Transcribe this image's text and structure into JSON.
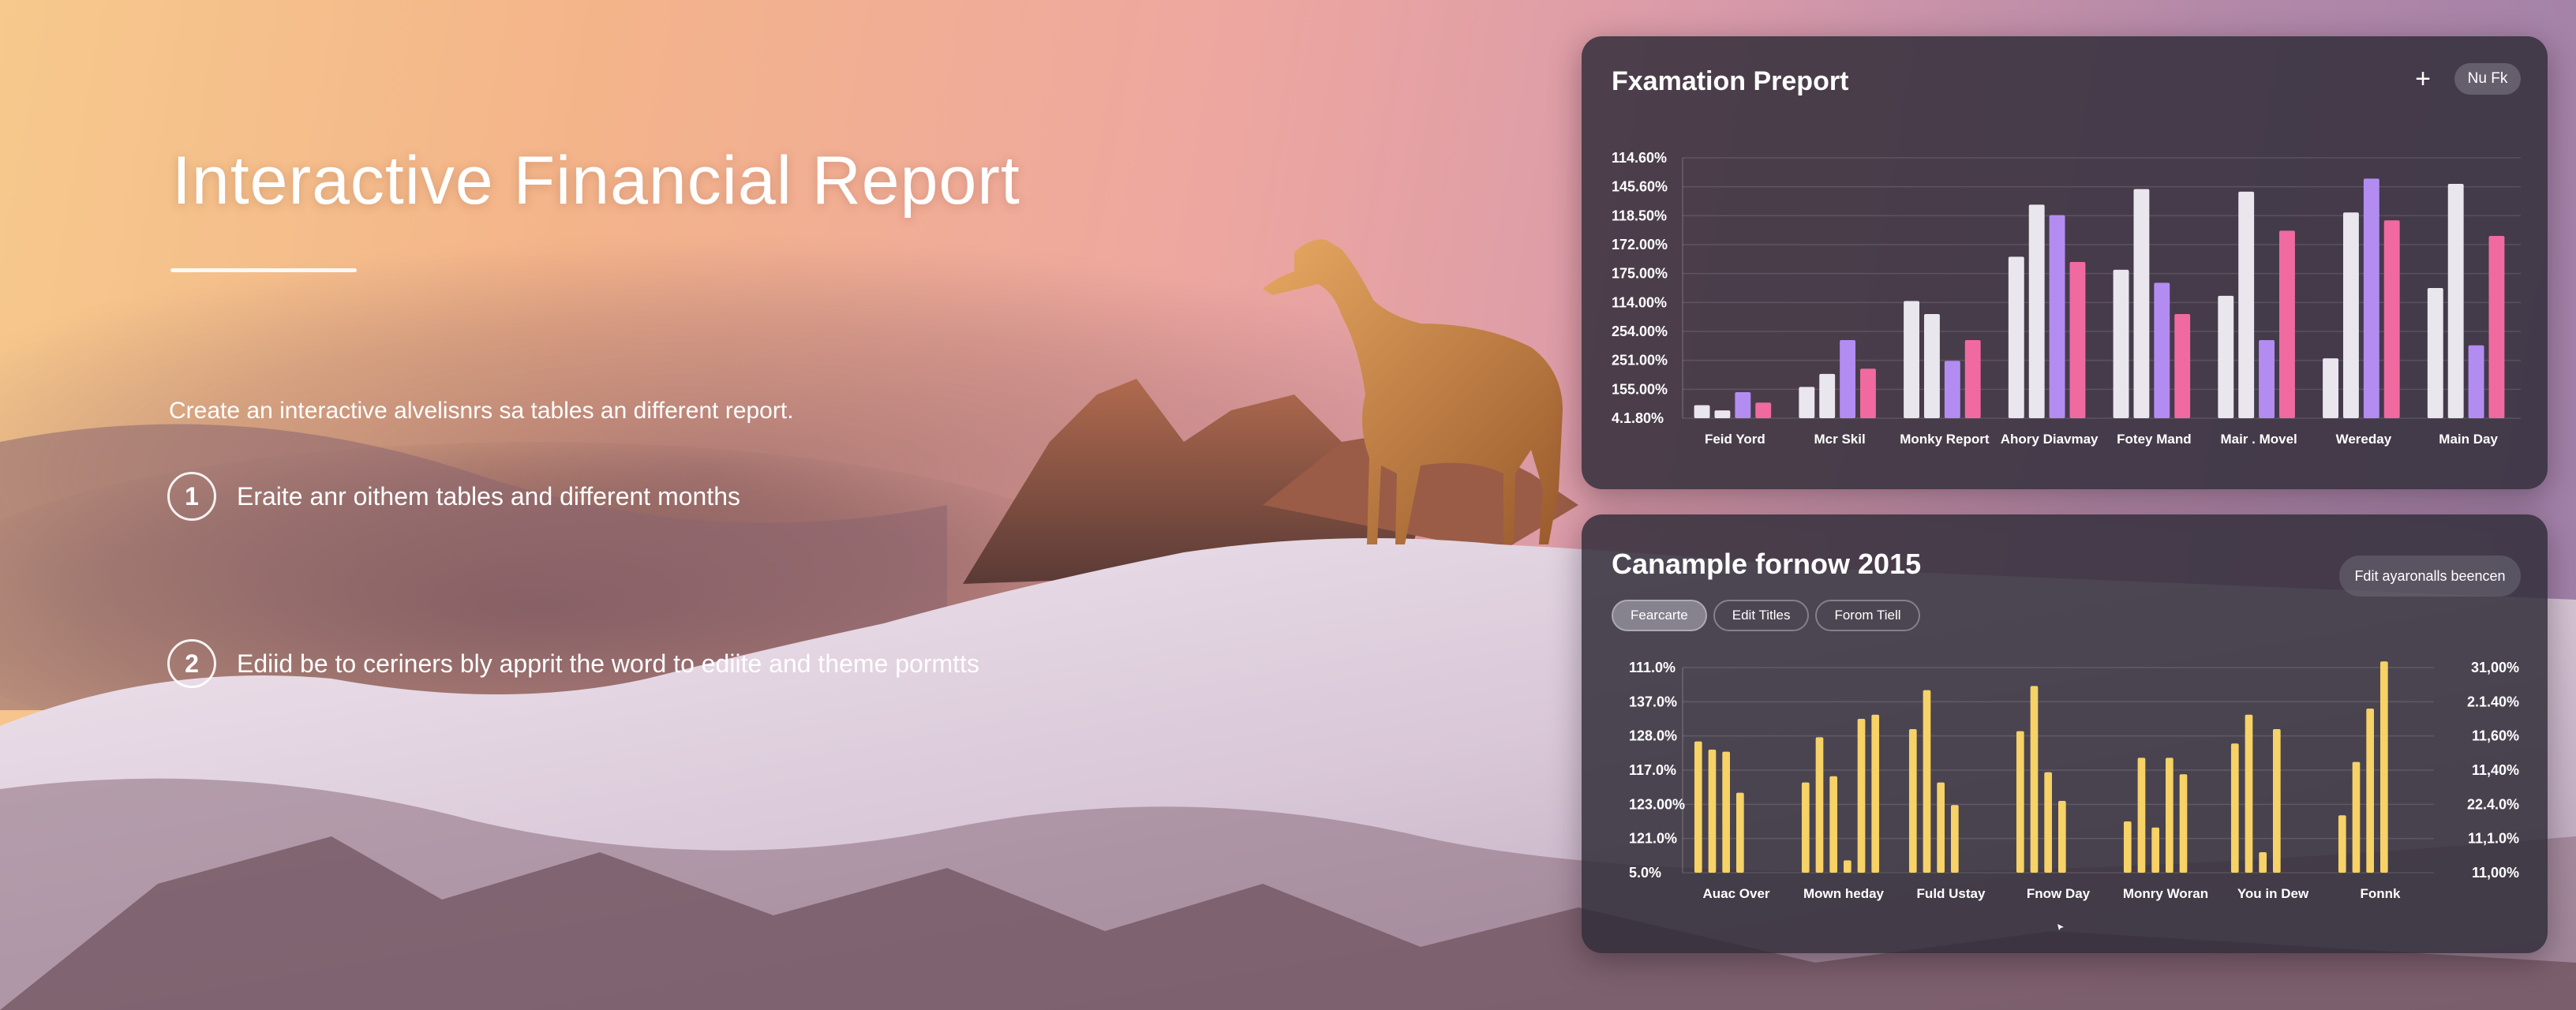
{
  "hero": {
    "title": "Interactive Financial Report",
    "subtitle": "Create an interactive alvelisnrs sa tables an different report.",
    "steps": [
      {
        "num": "1",
        "text": "Eraite anr oithem tables and different months"
      },
      {
        "num": "2",
        "text": "Ediid be to ceriners bly apprit the word to ediite and theme pormtts"
      }
    ]
  },
  "panel1": {
    "title": "Fxamation Preport",
    "plus_label": "+",
    "pill_label": "Nu Fk"
  },
  "panel2": {
    "title": "Canample fornow 2015",
    "edit_label": "Fdit ayaronalls beencen",
    "tabs": [
      "Fearcarte",
      "Edit Titles",
      "Forom Tiell"
    ]
  },
  "colors": {
    "white_bar": "#e9e6ee",
    "violet_bar": "#b38cf2",
    "pink_bar": "#f06aa0",
    "yellow_bar": "#f6d267",
    "panel_bg": "#302c38"
  },
  "chart_data": [
    {
      "type": "bar",
      "yticks": [
        "114.60%",
        "145.60%",
        "118.50%",
        "172.00%",
        "175.00%",
        "114.00%",
        "254.00%",
        "251.00%",
        "155.00%",
        "4.1.80%"
      ],
      "categories": [
        "Feid Yord",
        "Mcr Skil",
        "Monky Report",
        "Ahory Diavmay",
        "Fotey Mand",
        "Mair . Movel",
        "Wereday",
        "Main Day"
      ],
      "ylim": [
        0,
        100
      ],
      "grid": true,
      "series": [
        {
          "color": "#e9e6ee",
          "values": [
            5,
            12,
            45,
            62,
            57,
            47,
            23,
            50
          ]
        },
        {
          "color": "#e9e6ee",
          "values": [
            3,
            17,
            40,
            82,
            88,
            87,
            79,
            90
          ]
        },
        {
          "color": "#b38cf2",
          "values": [
            10,
            30,
            22,
            78,
            52,
            30,
            92,
            28
          ]
        },
        {
          "color": "#f06aa0",
          "values": [
            6,
            19,
            30,
            60,
            40,
            72,
            76,
            70
          ]
        }
      ]
    },
    {
      "type": "bar",
      "yticks_left": [
        "111.0%",
        "137.0%",
        "128.0%",
        "117.0%",
        "123.00%",
        "121.0%",
        "5.0%"
      ],
      "yticks_right": [
        "31,00%",
        "2.1.40%",
        "11,60%",
        "11,40%",
        "22.4.0%",
        "11,1.0%",
        "11,00%"
      ],
      "categories": [
        "Auac Over",
        "Mown  heday",
        "Fuld Ustay",
        "Fnow Day",
        "Monry  Woran",
        "You in Dew",
        "Fonnk"
      ],
      "ylim": [
        0,
        100
      ],
      "grid": true,
      "series": [
        {
          "color": "#f6d267",
          "values": [
            64,
            44,
            70,
            69,
            25,
            63,
            28
          ]
        },
        {
          "color": "#f6d267",
          "values": [
            60,
            66,
            89,
            91,
            56,
            77,
            54
          ]
        },
        {
          "color": "#f6d267",
          "values": [
            59,
            47,
            44,
            49,
            22,
            10,
            80
          ]
        },
        {
          "color": "#f6d267",
          "values": [
            39,
            6,
            33,
            35,
            56,
            70,
            103
          ]
        },
        {
          "color": "#f6d267",
          "values": [
            0,
            75,
            0,
            0,
            48,
            0,
            0
          ]
        },
        {
          "color": "#f6d267",
          "values": [
            0,
            77,
            0,
            0,
            0,
            0,
            0
          ]
        }
      ]
    }
  ]
}
